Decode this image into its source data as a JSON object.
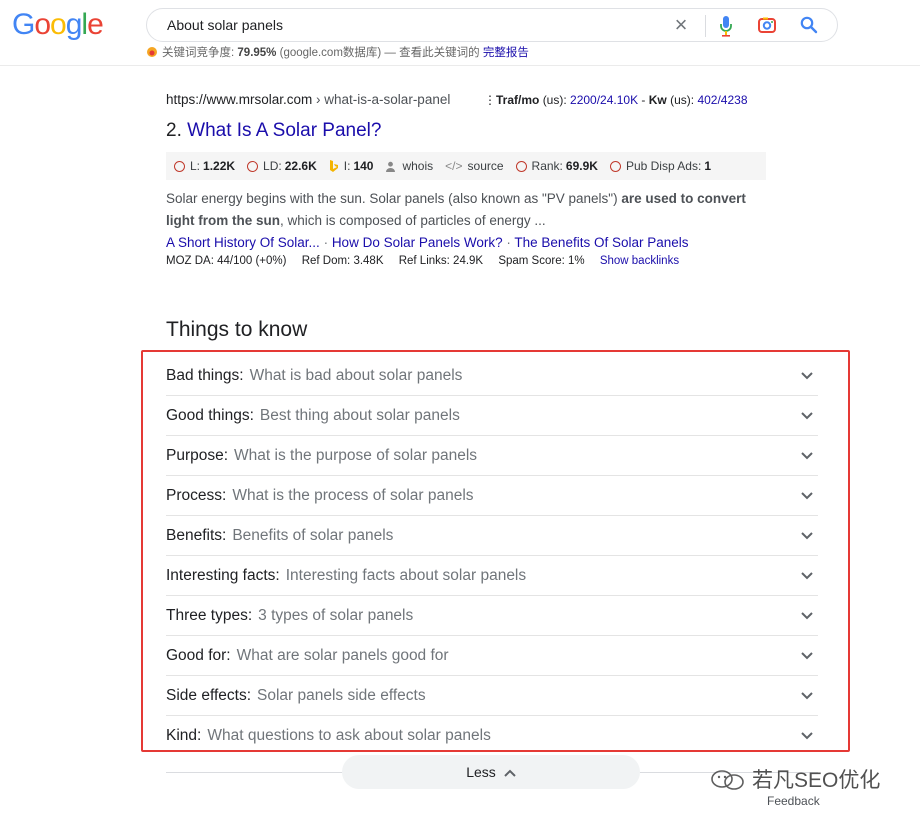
{
  "header": {
    "logo": "Google",
    "search_query": "About solar panels",
    "kw_prefix": "关键词竞争度:",
    "kw_value": "79.95%",
    "kw_middle": "(google.com数据库) — 查看此关键词的",
    "kw_link": "完整报告",
    "icons": [
      "clear-icon",
      "mic-icon",
      "lens-icon",
      "search-icon"
    ]
  },
  "result": {
    "domain": "https://www.mrsolar.com",
    "path": " › what-is-a-solar-panel",
    "traf_label": "Traf/mo",
    "traf_us": "(us):",
    "traf_value": "2200/24.10K",
    "kw_label": "Kw",
    "kw_us": "(us):",
    "kw_value": "402/4238",
    "number": "2.",
    "title": "What Is A Solar Panel?",
    "metrics": [
      {
        "label": "L:",
        "value": "1.22K"
      },
      {
        "label": "LD:",
        "value": "22.6K"
      },
      {
        "label": "I:",
        "value": "140"
      },
      {
        "label": "whois",
        "value": ""
      },
      {
        "label": "source",
        "value": ""
      },
      {
        "label": "Rank:",
        "value": "69.9K"
      },
      {
        "label": "Pub Disp Ads:",
        "value": "1"
      }
    ],
    "snippet_1": "Solar energy begins with the sun. Solar panels (also known as \"PV panels\") ",
    "snippet_bold_1": "are used to convert",
    "snippet_bold_2": "light from the sun",
    "snippet_2": ", which is composed of particles of energy ...",
    "sitelinks": [
      "A Short History Of Solar...",
      "How Do Solar Panels Work?",
      "The Benefits Of Solar Panels"
    ],
    "sitelink_sep": " · ",
    "moz_da": "MOZ DA: 44/100 (+0%)",
    "ref_dom": "Ref Dom: 3.48K",
    "ref_links": "Ref Links: 24.9K",
    "spam": "Spam Score: 1%",
    "backlinks": "Show backlinks"
  },
  "things_to_know": {
    "title": "Things to know",
    "items": [
      {
        "label": "Bad things:",
        "text": "What is bad about solar panels"
      },
      {
        "label": "Good things:",
        "text": "Best thing about solar panels"
      },
      {
        "label": "Purpose:",
        "text": "What is the purpose of solar panels"
      },
      {
        "label": "Process:",
        "text": "What is the process of solar panels"
      },
      {
        "label": "Benefits:",
        "text": "Benefits of solar panels"
      },
      {
        "label": "Interesting facts:",
        "text": "Interesting facts about solar panels"
      },
      {
        "label": "Three types:",
        "text": "3 types of solar panels"
      },
      {
        "label": "Good for:",
        "text": "What are solar panels good for"
      },
      {
        "label": "Side effects:",
        "text": "Solar panels side effects"
      },
      {
        "label": "Kind:",
        "text": "What questions to ask about solar panels"
      }
    ],
    "less_label": "Less",
    "feedback": "Feedback"
  },
  "watermark": "若凡SEO优化",
  "colors": {
    "link": "#1a0dab",
    "highlight_box": "#e53935",
    "metric_ring": "#c0392b"
  }
}
